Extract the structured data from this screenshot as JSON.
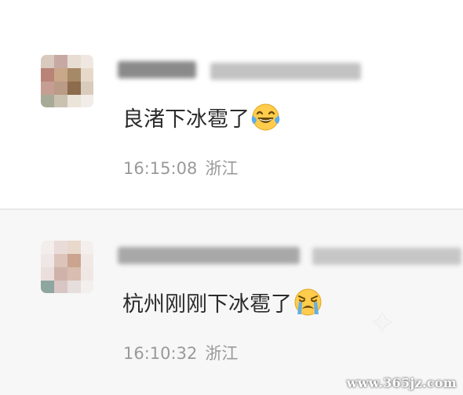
{
  "comments": [
    {
      "text": "良渚下冰雹了",
      "emoji": "laughing-tears-emoji",
      "time": "16:15:08",
      "location": "浙江"
    },
    {
      "text": "杭州刚刚下冰雹了",
      "emoji": "crying-emoji",
      "time": "16:10:32",
      "location": "浙江"
    }
  ],
  "watermark": "www.365jz.com"
}
